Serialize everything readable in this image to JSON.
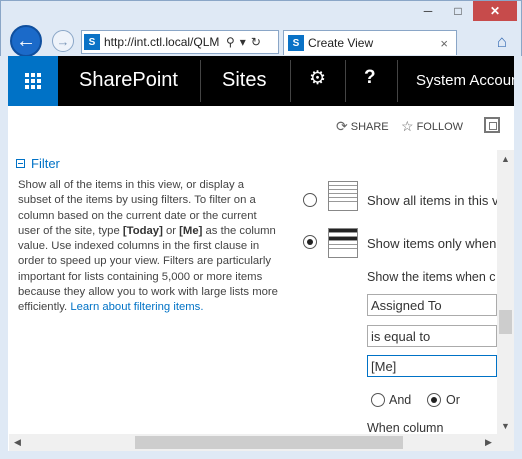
{
  "browser": {
    "address": "http://int.ctl.local/QLM",
    "tab_title": "Create View",
    "minimize": "─",
    "maximize": "□",
    "close": "✕"
  },
  "suite_bar": {
    "brand": "SharePoint",
    "sites": "Sites",
    "account": "System Accoun"
  },
  "actions": {
    "share": "SHARE",
    "follow": "FOLLOW"
  },
  "filter_section": {
    "heading": "Filter",
    "desc_1": "Show all of the items in this view, or display a subset of the items by using filters. To filter on a column based on the current date or the current user of the site, type ",
    "today": "[Today]",
    "or": " or ",
    "me": "[Me]",
    "desc_2": " as the column value. Use indexed columns in the first clause in order to speed up your view. Filters are particularly important for lists containing 5,000 or more items because they allow you to work with large lists more efficiently. ",
    "link": "Learn about filtering items."
  },
  "options": {
    "show_all": "Show all items in this v",
    "show_filtered": "Show items only when",
    "show_when": "Show the items when c",
    "field_column": "Assigned To",
    "field_operator": "is equal to",
    "field_value": "[Me]",
    "and_label": "And",
    "or_label": "Or",
    "when_column": "When column"
  },
  "colors": {
    "accent": "#0072c6",
    "suite_bar": "#000000"
  }
}
